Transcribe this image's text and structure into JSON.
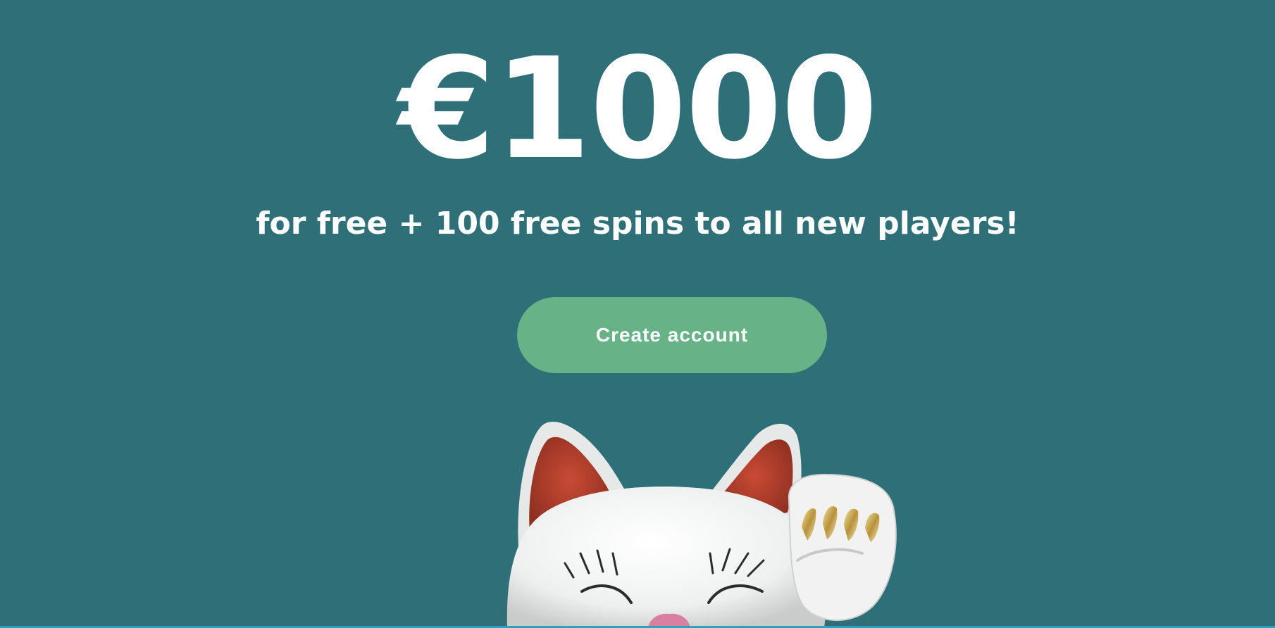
{
  "hero": {
    "amount": "€1000",
    "subtitle": "for free + 100 free spins to all new players!",
    "cta_label": "Create account"
  },
  "colors": {
    "background": "#2f6f77",
    "cta": "#67b286",
    "text": "#ffffff",
    "bottom_line": "#2aa4bf"
  },
  "image": {
    "subject": "lucky-cat-figurine"
  }
}
